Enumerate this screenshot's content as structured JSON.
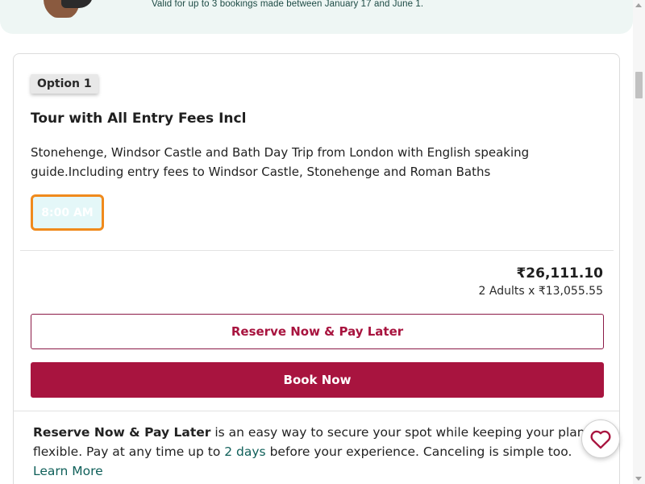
{
  "promo": {
    "text": "Valid for up to 3 bookings made between January 17 and June 1."
  },
  "option": {
    "badge": "Option 1",
    "title": "Tour with All Entry Fees Incl",
    "description": "Stonehenge, Windsor Castle and Bath Day Trip from London with English speaking guide.Including entry fees to Windsor Castle, Stonehenge and Roman Baths",
    "time_slot": "8:00 AM",
    "price_total": "₹26,111.10",
    "price_breakdown": "2 Adults x ₹13,055.55",
    "reserve_label": "Reserve Now & Pay Later",
    "book_label": "Book Now"
  },
  "rnpl": {
    "title": "Reserve Now & Pay Later",
    "text_1": "is an easy way to secure your spot while keeping your plans flexible. Pay at any time up to",
    "highlight": "2 days",
    "text_2": "before your experience. Canceling is simple too.",
    "learn_more": "Learn More"
  },
  "colors": {
    "brand": "#a8143f",
    "accent_teal": "#10605a",
    "slot_border": "#f08a1c"
  },
  "icons": {
    "favorite": "heart-icon"
  }
}
